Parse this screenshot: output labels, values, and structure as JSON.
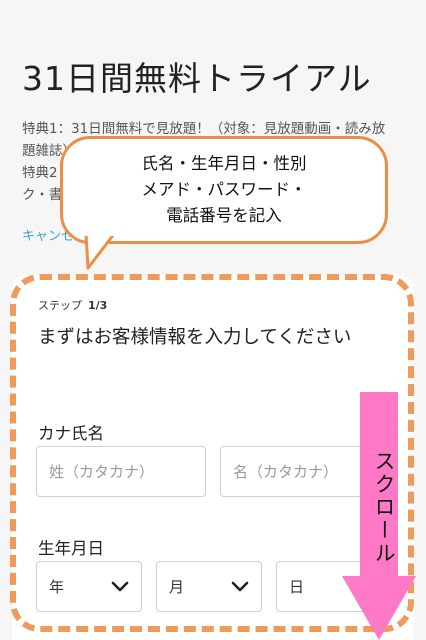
{
  "page": {
    "title": "31日間無料トライアル",
    "benefits": [
      "特典1：31日間無料で見放題！（対象：見放題動画・読み放",
      "題雑誌）",
      "特典2",
      "ク・書"
    ],
    "cancel_link": "キャンセ"
  },
  "callout": {
    "lines": [
      "氏名・生年月日・性別",
      "メアド・パスワード・",
      "電話番号を記入"
    ],
    "border_color": "#ee8e45"
  },
  "form": {
    "step_label": "ステップ",
    "step_value": "1/3",
    "heading": "まずはお客様情報を入力してください",
    "kana_label": "カナ氏名",
    "last_name_placeholder": "姓（カタカナ）",
    "first_name_placeholder": "名（カタカナ）",
    "birth_label": "生年月日",
    "year_select": "年",
    "month_select": "月",
    "day_select": "日"
  },
  "overlay": {
    "scroll_text": "スクロール",
    "arrow_color": "#ff79c6",
    "dash_color": "#ef9a5a"
  }
}
